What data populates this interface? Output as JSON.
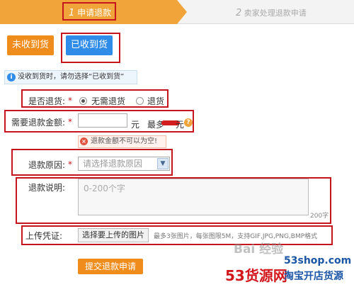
{
  "steps": {
    "step1_num": "1",
    "step1_label": "申请退款",
    "step2_num": "2",
    "step2_label": "卖家处理退款申请"
  },
  "tabs": {
    "not_received": "未收到货",
    "received": "已收到货"
  },
  "notice": "没收到货时，请勿选择“已收到货”",
  "form": {
    "return_goods": {
      "label": "是否退货:",
      "required": "*",
      "option_no_return": "无需退货",
      "option_return": "退货",
      "selected": "无需退货"
    },
    "amount": {
      "label": "需要退款金额:",
      "required": "*",
      "value": "",
      "unit": "元",
      "max_prefix": "最多",
      "max_unit": "元"
    },
    "error_text": "退款金额不可以为空!",
    "reason": {
      "label": "退款原因:",
      "required": "*",
      "placeholder": "请选择退款原因"
    },
    "description": {
      "label": "退款说明:",
      "placeholder": "0-200个字",
      "counter": "200字"
    },
    "upload": {
      "label": "上传凭证:",
      "button": "选择要上传的图片",
      "hint": "最多3张图片，每张图限5M，支持GIF,JPG,PNG,BMP格式"
    },
    "submit": "提交退款申请"
  },
  "watermarks": {
    "baidu": "Bai 经验",
    "site_name": "53货源网",
    "site_url": "53shop.com",
    "slogan": "淘宝开店货源"
  },
  "colors": {
    "accent_orange": "#f08c1c",
    "accent_blue": "#2f8ce8",
    "annotation_red": "#c4161c"
  }
}
